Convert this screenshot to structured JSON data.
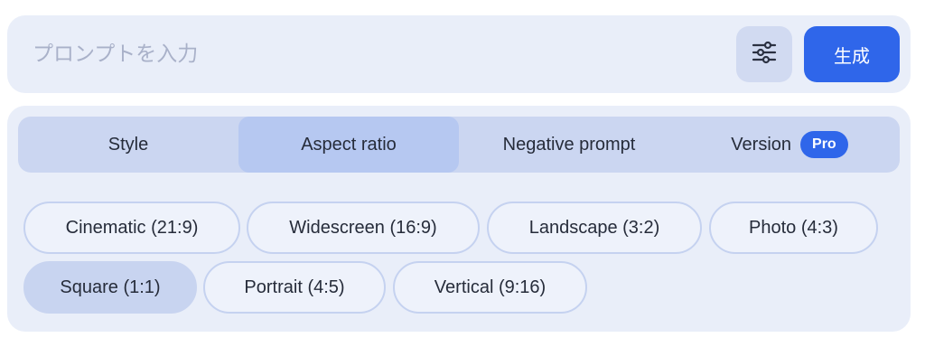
{
  "prompt": {
    "placeholder": "プロンプトを入力",
    "value": ""
  },
  "buttons": {
    "settings_icon": "sliders-icon",
    "generate_label": "生成"
  },
  "tabs": [
    {
      "label": "Style",
      "active": false
    },
    {
      "label": "Aspect ratio",
      "active": true
    },
    {
      "label": "Negative prompt",
      "active": false
    },
    {
      "label": "Version",
      "active": false,
      "badge": "Pro"
    }
  ],
  "aspect_ratios": [
    {
      "label": "Cinematic (21:9)",
      "selected": false
    },
    {
      "label": "Widescreen (16:9)",
      "selected": false
    },
    {
      "label": "Landscape (3:2)",
      "selected": false
    },
    {
      "label": "Photo (4:3)",
      "selected": false
    },
    {
      "label": "Square (1:1)",
      "selected": true
    },
    {
      "label": "Portrait (4:5)",
      "selected": false
    },
    {
      "label": "Vertical (9:16)",
      "selected": false
    }
  ],
  "colors": {
    "accent": "#2f66ea",
    "panel": "#e9eef9",
    "tab_bar": "#cbd6f1",
    "tab_active": "#b6c8f1",
    "chip_selected": "#c8d4f0"
  }
}
